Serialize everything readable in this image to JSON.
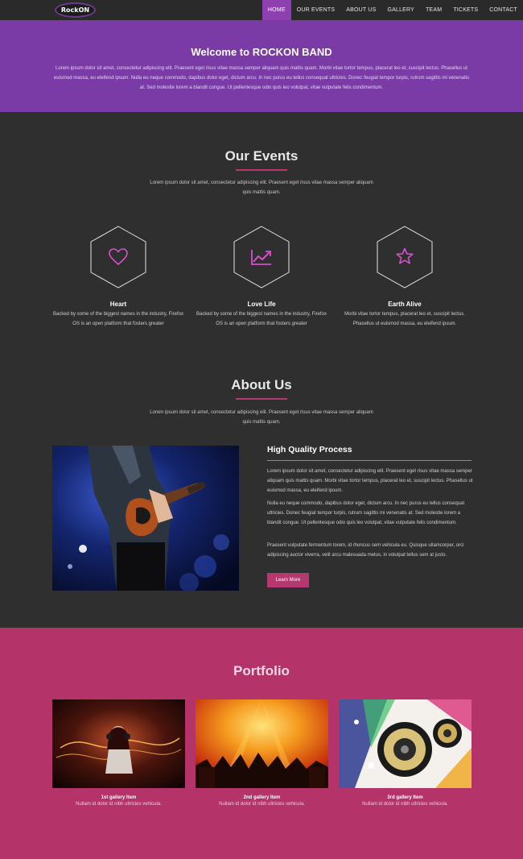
{
  "nav": {
    "logo": "RockON",
    "items": [
      {
        "label": "HOME",
        "active": true
      },
      {
        "label": "OUR EVENTS",
        "active": false
      },
      {
        "label": "ABOUT US",
        "active": false
      },
      {
        "label": "GALLERY",
        "active": false
      },
      {
        "label": "TEAM",
        "active": false
      },
      {
        "label": "TICKETS",
        "active": false
      },
      {
        "label": "CONTACT",
        "active": false
      }
    ]
  },
  "hero": {
    "title": "Welcome to ROCKON BAND",
    "text": "Lorem ipsum dolor sit amet, consectetur adipiscing elit. Praesent eget risus vitae massa semper aliquam quis mattis quam. Morbi vitae tortor tempus, placerat leo et, suscipit lectus. Phasellus ut euismod massa, eu eleifend ipsum. Nulla eu neque commodo, dapibus dolor eget, dictum arcu. In nec purus eu tellus consequat ultricies. Donec feugiat tempor turpis, rutrum sagittis mi venenatis at. Sed molestie lorem a blandit congue. Ut pellentesque odio quis leo volutpat, vitae vulputate felis condimentum."
  },
  "events": {
    "title": "Our Events",
    "subtitle": "Lorem ipsum dolor sit amet, consectetur adipiscing elit. Praesent eget risus vitae massa semper aliquam quis mattis quam.",
    "items": [
      {
        "icon": "heart-icon",
        "title": "Heart",
        "text": "Backed by some of the biggest names in the industry, Firefox OS is an open platform that fosters greater"
      },
      {
        "icon": "chart-trend-icon",
        "title": "Love Life",
        "text": "Backed by some of the biggest names in the industry, Firefox OS is an open platform that fosters greater"
      },
      {
        "icon": "star-icon",
        "title": "Earth Alive",
        "text": "Morbi vitae tortor tempus, placerat leo et, suscipit lectus. Phasellus ut euismod massa, eu eleifend ipsum."
      }
    ]
  },
  "about": {
    "title": "About Us",
    "subtitle": "Lorem ipsum dolor sit amet, consectetur adipiscing elit. Praesent eget risus vitae massa semper aliquam quis mattis quam.",
    "heading": "High Quality Process",
    "paragraphs": [
      "Lorem ipsum dolor sit amet, consectetur adipiscing elit. Praesent eget risus vitae massa semper aliquam quis mattis quam. Morbi vitae tortor tempus, placerat leo et, suscipit lectus. Phasellus ut euismod massa, eu eleifend ipsum.",
      "Nulla eu neque commodo, dapibus dolor eget, dictum arcu. In nec purus eu tellus consequat ultricies. Donec feugiat tempor turpis, rutrum sagittis mi venenatis at. Sed molestie lorem a blandit congue. Ut pellentesque odio quis leo volutpat, vitae vulputate felis condimentum.",
      "Praesent vulputate fermentum lorem, id rhoncus sem vehicula eu. Quisque ullamcorper, orci adipiscing auctor viverra, velit arcu malesuada metus, in volutpat tellus sem at justo."
    ],
    "button": "Learn More"
  },
  "portfolio": {
    "title": "Portfolio",
    "items": [
      {
        "title": "1st gallery Item",
        "text": "Nullam id dolor id nibh ultricies vehicula."
      },
      {
        "title": "2nd gallery Item",
        "text": "Nullam id dolor id nibh ultricies vehicula."
      },
      {
        "title": "3rd gallery Item",
        "text": "Nullam id dolor id nibh ultricies vehicula."
      }
    ]
  },
  "colors": {
    "accent": "#b5386f",
    "hero": "#7a3ba6",
    "icon": "#d84fd0"
  }
}
